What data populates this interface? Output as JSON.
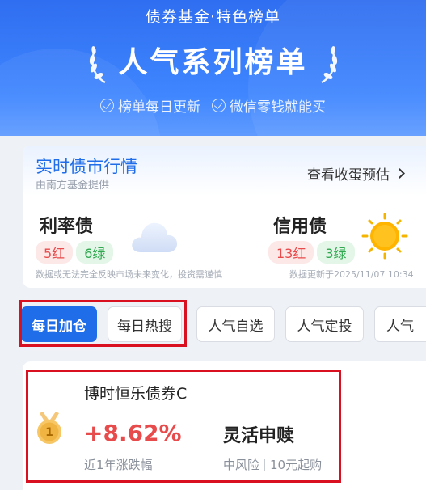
{
  "banner": {
    "subtitle": "债券基金·特色榜单",
    "title": "人气系列榜单",
    "features": [
      {
        "icon": "check-circle-icon",
        "label": "榜单每日更新"
      },
      {
        "icon": "check-circle-icon",
        "label": "微信零钱就能买"
      }
    ]
  },
  "market": {
    "title": "实时债市行情",
    "source": "由南方基金提供",
    "valuation_link": "查看收蛋预估",
    "rate_bond": {
      "name": "利率债",
      "red": "5红",
      "green": "6绿",
      "weather_icon": "cloud-icon"
    },
    "credit_bond": {
      "name": "信用债",
      "red": "13红",
      "green": "3绿",
      "weather_icon": "sun-icon"
    },
    "disclaimer": "数据或无法完全反映市场未来变化，投资需谨慎",
    "update_time": "数据更新于2025/11/07 10:34"
  },
  "tabs": [
    {
      "label": "每日加仓",
      "active": true
    },
    {
      "label": "每日热搜",
      "active": false
    },
    {
      "label": "人气自选",
      "active": false
    },
    {
      "label": "人气定投",
      "active": false
    },
    {
      "label": "人气",
      "active": false
    }
  ],
  "fund": {
    "rank": "1",
    "name": "博时恒乐债券C",
    "return_value": "+8.62%",
    "return_label": "近1年涨跌幅",
    "redeem": "灵活申赎",
    "risk": "中风险",
    "min_amount": "10元起购"
  },
  "colors": {
    "brand_blue": "#1f6de8",
    "up_red": "#e84b4b",
    "down_green": "#2fa84f",
    "highlight": "#d9101f"
  }
}
